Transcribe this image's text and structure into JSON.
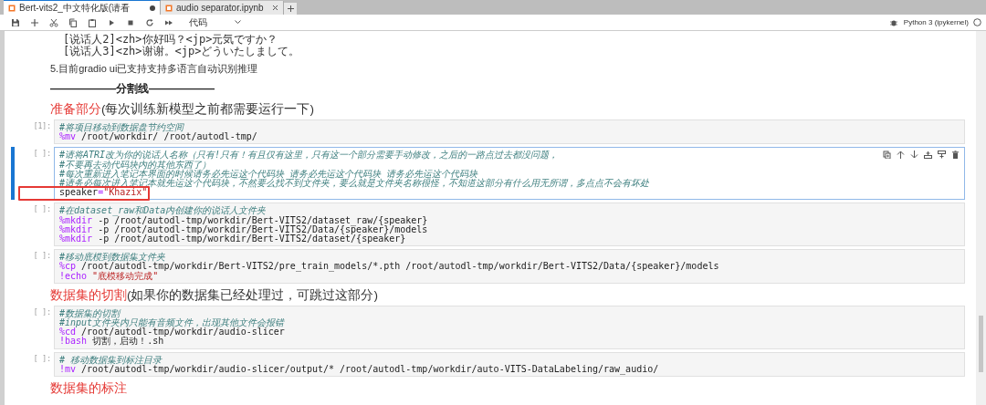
{
  "tabs": [
    {
      "label": "Bert-vits2_中文特化版(请看",
      "selected": true,
      "unsaved": true
    },
    {
      "label": "audio separator.ipynb",
      "selected": false,
      "unsaved": false
    }
  ],
  "toolbar": {
    "cell_type": "代码",
    "kernel": "Python 3 (ipykernel)",
    "kernel_busy": false
  },
  "cells": [
    {
      "kind": "pre",
      "lines": [
        "[说话人2]<zh>你好吗？<jp>元気ですか？",
        "[说话人3]<zh>谢谢。<jp>どういたしまして。"
      ]
    },
    {
      "kind": "text",
      "text": "5.目前gradio ui已支持支持多语言自动识别推理"
    },
    {
      "kind": "divider",
      "text": "——————分割线——————"
    },
    {
      "kind": "heading",
      "accent": "准备部分",
      "rest": "(每次训练新模型之前都需要运行一下)"
    },
    {
      "kind": "code",
      "prompt": "[1]:",
      "selected": false,
      "lines": [
        {
          "boxed": false,
          "tokens": [
            {
              "t": "#将项目移动到数据盘节约空间",
              "kind": "comment"
            }
          ]
        },
        {
          "boxed": false,
          "tokens": [
            {
              "t": "%mv",
              "kind": "magic"
            },
            {
              "t": " /root/workdir/ /root/autodl-tmp/",
              "kind": "plain"
            }
          ]
        }
      ]
    },
    {
      "kind": "code",
      "prompt": "[ ]:",
      "selected": true,
      "lines": [
        {
          "boxed": false,
          "tokens": [
            {
              "t": "#请将ATRI改为你的说话人名称（只有!只有！有且仅有这里，只有这一个部分需要手动修改，之后的一路点过去都没问题，",
              "kind": "comment"
            }
          ]
        },
        {
          "boxed": false,
          "tokens": [
            {
              "t": "#不要再去动代码块内的其他东西了）",
              "kind": "comment"
            }
          ]
        },
        {
          "boxed": false,
          "tokens": [
            {
              "t": "#每次重新进入笔记本界面的时候请务必先运这个代码块 请务必先运这个代码块 请务必先运这个代码块",
              "kind": "comment"
            }
          ]
        },
        {
          "boxed": false,
          "tokens": [
            {
              "t": "#请务必每次进入笔记本就先运这个代码块，不然要么找不到文件夹，要么就是文件夹名称很怪，不知道这部分有什么用无所谓，多点点不会有坏处",
              "kind": "comment"
            }
          ]
        },
        {
          "boxed": true,
          "tokens": [
            {
              "t": "speaker",
              "kind": "plain"
            },
            {
              "t": "=",
              "kind": "op"
            },
            {
              "t": "\"Khazix\"",
              "kind": "string"
            }
          ]
        }
      ]
    },
    {
      "kind": "code",
      "prompt": "[ ]:",
      "selected": false,
      "lines": [
        {
          "boxed": false,
          "tokens": [
            {
              "t": "#在dataset_raw和Data内创建你的说话人文件夹",
              "kind": "comment"
            }
          ]
        },
        {
          "boxed": false,
          "tokens": [
            {
              "t": "%mkdir",
              "kind": "magic"
            },
            {
              "t": " -p /root/autodl-tmp/workdir/Bert-VITS2/dataset_raw/{speaker}",
              "kind": "plain"
            }
          ]
        },
        {
          "boxed": false,
          "tokens": [
            {
              "t": "%mkdir",
              "kind": "magic"
            },
            {
              "t": " -p /root/autodl-tmp/workdir/Bert-VITS2/Data/{speaker}/models",
              "kind": "plain"
            }
          ]
        },
        {
          "boxed": false,
          "tokens": [
            {
              "t": "%mkdir",
              "kind": "magic"
            },
            {
              "t": " -p /root/autodl-tmp/workdir/Bert-VITS2/dataset/{speaker}",
              "kind": "plain"
            }
          ]
        }
      ]
    },
    {
      "kind": "code",
      "prompt": "[ ]:",
      "selected": false,
      "lines": [
        {
          "boxed": false,
          "tokens": [
            {
              "t": "#移动底模到数据集文件夹",
              "kind": "comment"
            }
          ]
        },
        {
          "boxed": false,
          "tokens": [
            {
              "t": "%cp",
              "kind": "magic"
            },
            {
              "t": " /root/autodl-tmp/workdir/Bert-VITS2/pre_train_models/*.pth /root/autodl-tmp/workdir/Bert-VITS2/Data/{speaker}/models",
              "kind": "plain"
            }
          ]
        },
        {
          "boxed": false,
          "tokens": [
            {
              "t": "!echo",
              "kind": "magic"
            },
            {
              "t": "\"底模移动完成\"",
              "kind": "string"
            }
          ]
        }
      ]
    },
    {
      "kind": "heading",
      "accent": "数据集的切割",
      "rest": "(如果你的数据集已经处理过，可跳过这部分)"
    },
    {
      "kind": "code",
      "prompt": "[ ]:",
      "selected": false,
      "lines": [
        {
          "boxed": false,
          "tokens": [
            {
              "t": "#数据集的切割",
              "kind": "comment"
            }
          ]
        },
        {
          "boxed": false,
          "tokens": [
            {
              "t": "#input文件夹内只能有音频文件，出现其他文件会报错",
              "kind": "comment"
            }
          ]
        },
        {
          "boxed": false,
          "tokens": [
            {
              "t": "%cd",
              "kind": "magic"
            },
            {
              "t": " /root/autodl-tmp/workdir/audio-slicer",
              "kind": "plain"
            }
          ]
        },
        {
          "boxed": false,
          "tokens": [
            {
              "t": "!bash",
              "kind": "magic"
            },
            {
              "t": " 切割，启动！.sh",
              "kind": "plain"
            }
          ]
        }
      ]
    },
    {
      "kind": "code",
      "prompt": "[ ]:",
      "selected": false,
      "lines": [
        {
          "boxed": false,
          "tokens": [
            {
              "t": "# 移动数据集到标注目录",
              "kind": "comment"
            }
          ]
        },
        {
          "boxed": false,
          "tokens": [
            {
              "t": "!mv",
              "kind": "magic"
            },
            {
              "t": " /root/autodl-tmp/workdir/audio-slicer/output/* /root/autodl-tmp/workdir/auto-VITS-DataLabeling/raw_audio/",
              "kind": "plain"
            }
          ]
        }
      ]
    },
    {
      "kind": "heading",
      "accent": "数据集的标注"
    }
  ]
}
